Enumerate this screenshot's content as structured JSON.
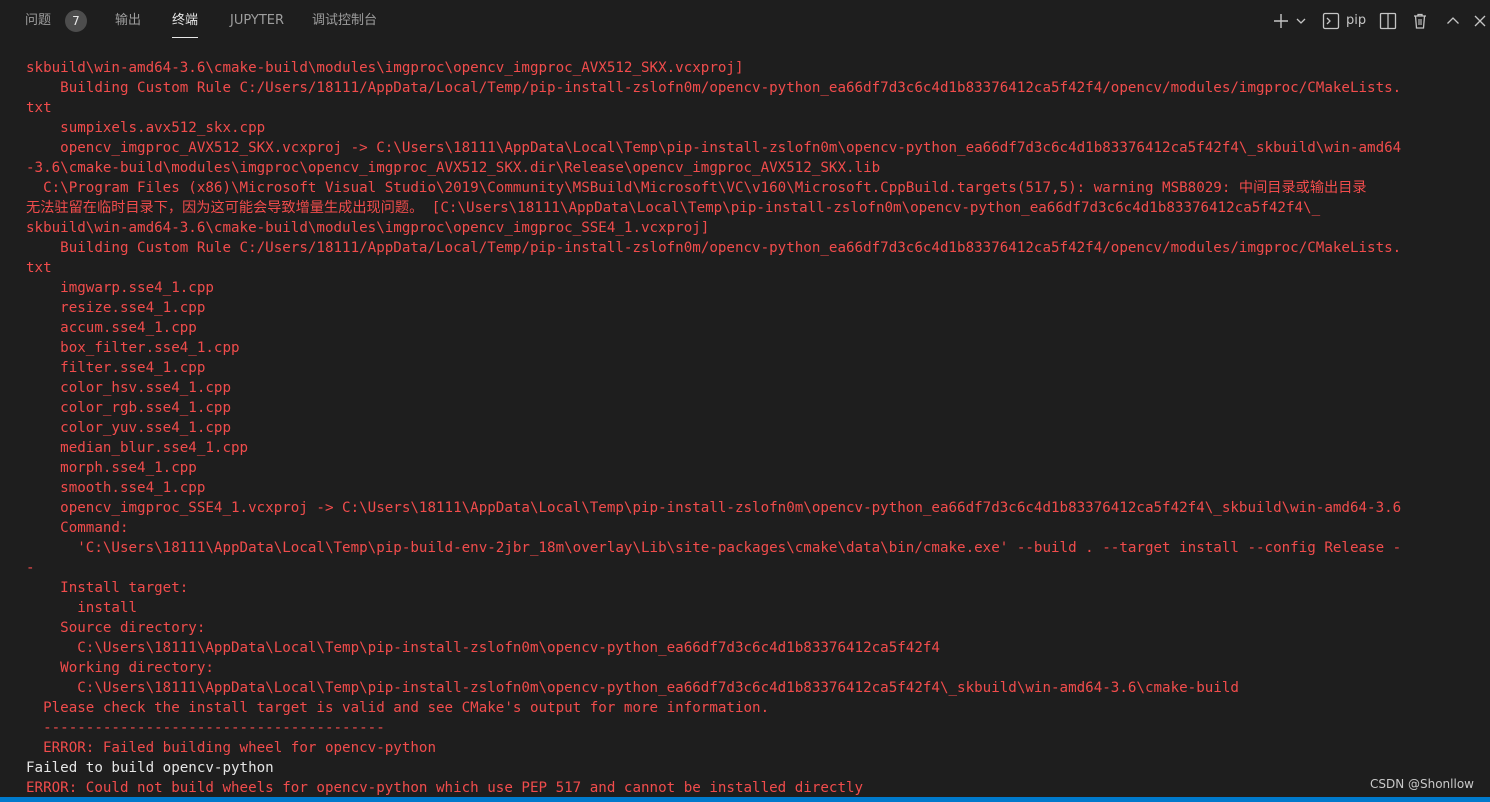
{
  "tabs": {
    "problems": "问题",
    "problems_count": "7",
    "output": "输出",
    "terminal": "终端",
    "jupyter": "JUPYTER",
    "debug_console": "调试控制台"
  },
  "toolbar": {
    "terminal_name": "pip"
  },
  "terminal_lines": [
    "skbuild\\win-amd64-3.6\\cmake-build\\modules\\imgproc\\opencv_imgproc_AVX512_SKX.vcxproj]",
    "    Building Custom Rule C:/Users/18111/AppData/Local/Temp/pip-install-zslofn0m/opencv-python_ea66df7d3c6c4d1b83376412ca5f42f4/opencv/modules/imgproc/CMakeLists.",
    "txt",
    "    sumpixels.avx512_skx.cpp",
    "    opencv_imgproc_AVX512_SKX.vcxproj -> C:\\Users\\18111\\AppData\\Local\\Temp\\pip-install-zslofn0m\\opencv-python_ea66df7d3c6c4d1b83376412ca5f42f4\\_skbuild\\win-amd64",
    "-3.6\\cmake-build\\modules\\imgproc\\opencv_imgproc_AVX512_SKX.dir\\Release\\opencv_imgproc_AVX512_SKX.lib",
    "  C:\\Program Files (x86)\\Microsoft Visual Studio\\2019\\Community\\MSBuild\\Microsoft\\VC\\v160\\Microsoft.CppBuild.targets(517,5): warning MSB8029: 中间目录或输出目录",
    "无法驻留在临时目录下，因为这可能会导致增量生成出现问题。 [C:\\Users\\18111\\AppData\\Local\\Temp\\pip-install-zslofn0m\\opencv-python_ea66df7d3c6c4d1b83376412ca5f42f4\\_",
    "skbuild\\win-amd64-3.6\\cmake-build\\modules\\imgproc\\opencv_imgproc_SSE4_1.vcxproj]",
    "    Building Custom Rule C:/Users/18111/AppData/Local/Temp/pip-install-zslofn0m/opencv-python_ea66df7d3c6c4d1b83376412ca5f42f4/opencv/modules/imgproc/CMakeLists.",
    "txt",
    "    imgwarp.sse4_1.cpp",
    "    resize.sse4_1.cpp",
    "    accum.sse4_1.cpp",
    "    box_filter.sse4_1.cpp",
    "    filter.sse4_1.cpp",
    "    color_hsv.sse4_1.cpp",
    "    color_rgb.sse4_1.cpp",
    "    color_yuv.sse4_1.cpp",
    "    median_blur.sse4_1.cpp",
    "    morph.sse4_1.cpp",
    "    smooth.sse4_1.cpp",
    "    opencv_imgproc_SSE4_1.vcxproj -> C:\\Users\\18111\\AppData\\Local\\Temp\\pip-install-zslofn0m\\opencv-python_ea66df7d3c6c4d1b83376412ca5f42f4\\_skbuild\\win-amd64-3.6",
    "    Command:",
    "      'C:\\Users\\18111\\AppData\\Local\\Temp\\pip-build-env-2jbr_18m\\overlay\\Lib\\site-packages\\cmake\\data\\bin/cmake.exe' --build . --target install --config Release -",
    "-",
    "    Install target:",
    "      install",
    "    Source directory:",
    "      C:\\Users\\18111\\AppData\\Local\\Temp\\pip-install-zslofn0m\\opencv-python_ea66df7d3c6c4d1b83376412ca5f42f4",
    "    Working directory:",
    "      C:\\Users\\18111\\AppData\\Local\\Temp\\pip-install-zslofn0m\\opencv-python_ea66df7d3c6c4d1b83376412ca5f42f4\\_skbuild\\win-amd64-3.6\\cmake-build",
    "  Please check the install target is valid and see CMake's output for more information.",
    "  ----------------------------------------",
    "  ERROR: Failed building wheel for opencv-python",
    "Failed to build opencv-python",
    "ERROR: Could not build wheels for opencv-python which use PEP 517 and cannot be installed directly"
  ],
  "watermark": "CSDN @Shonllow",
  "colors": {
    "background": "#1e1e1e",
    "error_text": "#f14c4c",
    "normal_text": "#e5e5e5",
    "accent": "#007acc"
  },
  "icons": [
    "plus-icon",
    "chevron-down-icon",
    "terminal-icon",
    "split-icon",
    "trash-icon",
    "chevron-up-icon",
    "close-icon"
  ]
}
